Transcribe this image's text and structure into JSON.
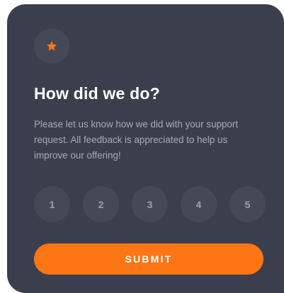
{
  "icon": "star-icon",
  "colors": {
    "card_bg": "#3b3f4d",
    "circle_bg": "#444857",
    "accent": "#fc7614",
    "title": "#ffffff",
    "body_text": "#a6aab8"
  },
  "card": {
    "title": "How did we do?",
    "description": "Please let us know how we did with your support request. All feedback is appreciated to help us improve our offering!"
  },
  "ratings": [
    "1",
    "2",
    "3",
    "4",
    "5"
  ],
  "submit_label": "SUBMIT"
}
